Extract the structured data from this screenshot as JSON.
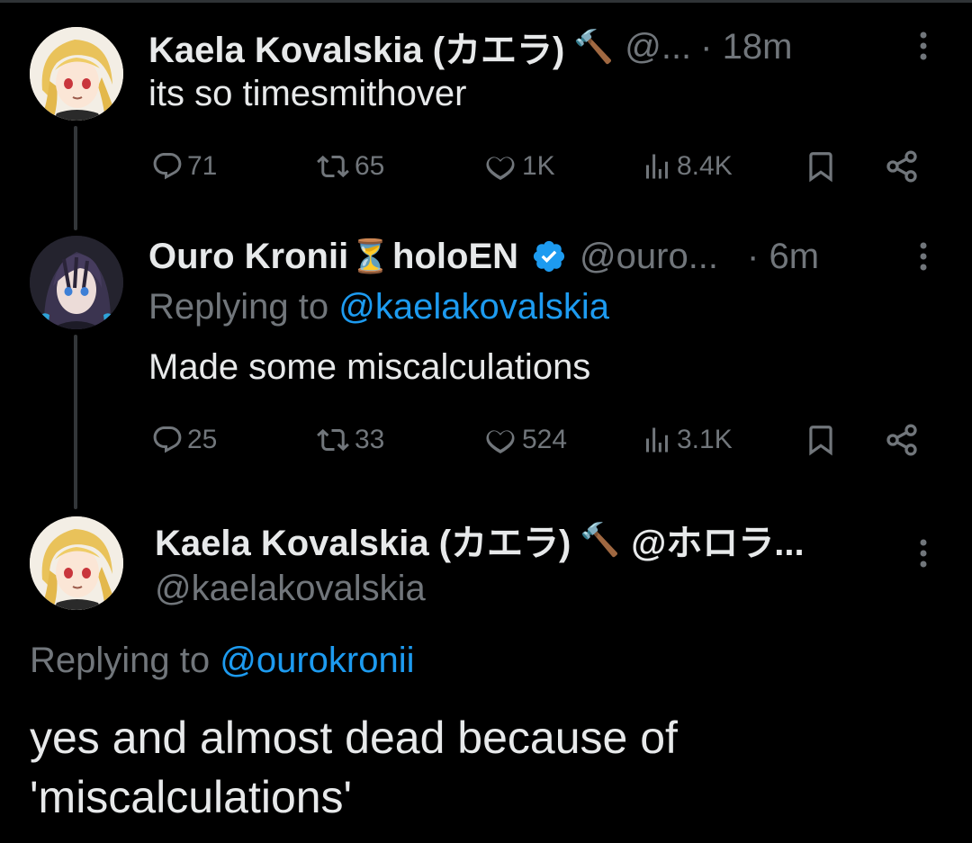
{
  "tweets": [
    {
      "display_name": "Kaela Kovalskia (カエラ)",
      "name_emoji": "🔨",
      "handle": "@...",
      "time": "· 18m",
      "text": "its so timesmithover",
      "stats": {
        "replies": "71",
        "reposts": "65",
        "likes": "1K",
        "views": "8.4K"
      }
    },
    {
      "display_name_a": "Ouro Kronii",
      "name_emoji": "⏳",
      "display_name_b": "holoEN",
      "handle": "@ouro...",
      "time": "· 6m",
      "replying_prefix": "Replying to ",
      "replying_to": "@kaelakovalskia",
      "text": "Made some miscalculations",
      "stats": {
        "replies": "25",
        "reposts": "33",
        "likes": "524",
        "views": "3.1K"
      }
    }
  ],
  "focused": {
    "display_name": "Kaela Kovalskia (カエラ)",
    "name_emoji": "🔨",
    "handle_jp": "@ホロラ...",
    "handle": "@kaelakovalskia",
    "replying_prefix": "Replying to ",
    "replying_to": "@ourokronii",
    "text_line1": "yes and almost dead because of",
    "text_line2": "'miscalculations'"
  },
  "colors": {
    "accent": "#1d9bf0",
    "muted": "#71767b",
    "text": "#e7e9ea",
    "background": "#000000"
  },
  "icons": [
    "reply-icon",
    "repost-icon",
    "like-icon",
    "views-icon",
    "bookmark-icon",
    "share-icon",
    "more-icon",
    "verified-badge-icon"
  ]
}
